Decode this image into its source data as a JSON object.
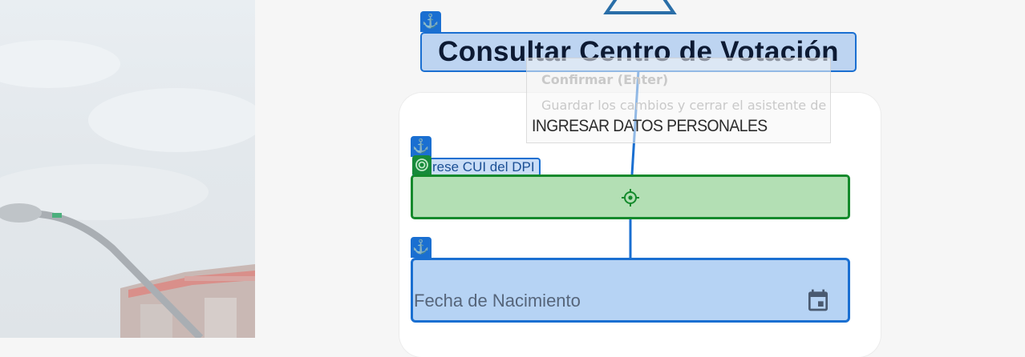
{
  "page": {
    "title": "Consultar Centro de Votación",
    "section_title": "INGRESAR DATOS PERSONALES"
  },
  "tooltip": {
    "title": "Confirmar (Enter)",
    "body": "Guardar los cambios y cerrar el asistente de"
  },
  "form": {
    "cui_label": "rese CUI del DPI",
    "birthdate_placeholder": "Fecha de Nacimiento"
  },
  "icons": {
    "anchor": "anchor-icon",
    "target": "target-icon",
    "crosshair": "crosshair-icon",
    "calendar": "calendar-icon"
  },
  "colors": {
    "annotation_blue": "#1a6fd1",
    "annotation_green": "#148a2c",
    "card_bg": "#ffffff",
    "page_bg": "#f6f6f6"
  }
}
